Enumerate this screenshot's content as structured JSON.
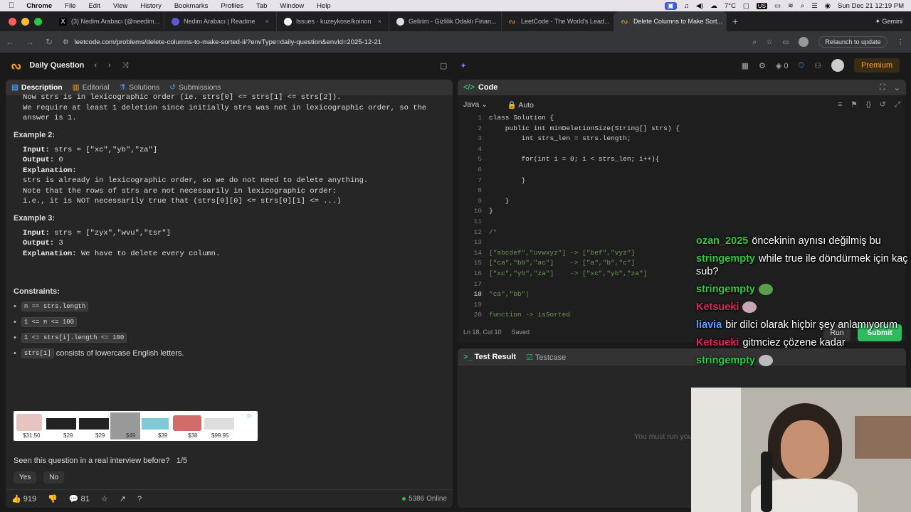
{
  "macos": {
    "app": "Chrome",
    "menus": [
      "File",
      "Edit",
      "View",
      "History",
      "Bookmarks",
      "Profiles",
      "Tab",
      "Window",
      "Help"
    ],
    "temp": "7°C",
    "input": "US",
    "datetime": "Sun Dec 21  12:19 PM"
  },
  "tabs": [
    {
      "label": "(3) Nedim Arabacı (@needim...",
      "color": "#000000"
    },
    {
      "label": "Nedim Arabacı | Readme",
      "color": "#5b5bd6"
    },
    {
      "label": "Issues · kuzeykose/koinon",
      "color": "#ffffff"
    },
    {
      "label": "Gelirim - Gizlilik Odaklı Finan...",
      "color": "#ffffff"
    },
    {
      "label": "LeetCode - The World's Lead...",
      "color": "#ffa116"
    },
    {
      "label": "Delete Columns to Make Sort...",
      "color": "#ffa116"
    }
  ],
  "gemini": "Gemini",
  "address": {
    "url": "leetcode.com/problems/delete-columns-to-make-sorted-ii/?envType=daily-question&envId=2025-12-21",
    "relaunch": "Relaunch to update"
  },
  "lc": {
    "title": "Daily Question",
    "fire": "0",
    "premium": "Premium"
  },
  "left_tabs": {
    "description": "Description",
    "editorial": "Editorial",
    "solutions": "Solutions",
    "submissions": "Submissions"
  },
  "desc": {
    "top1": "Now strs is in lexicographic order (ie. strs[0] <= strs[1] <= strs[2]).",
    "top2": "We require at least 1 deletion since initially strs was not in lexicographic order, so the",
    "top3": "answer is 1.",
    "ex2": "Example 2:",
    "ex2_input_label": "Input:",
    "ex2_input": "strs = [\"xc\",\"yb\",\"za\"]",
    "ex2_output_label": "Output:",
    "ex2_output": "0",
    "ex2_expl_label": "Explanation:",
    "ex2_l1": "strs is already in lexicographic order, so we do not need to delete anything.",
    "ex2_l2": "Note that the rows of strs are not necessarily in lexicographic order:",
    "ex2_l3": "i.e., it is NOT necessarily true that (strs[0][0] <= strs[0][1] <= ...)",
    "ex3": "Example 3:",
    "ex3_input_label": "Input:",
    "ex3_input": "strs = [\"zyx\",\"wvu\",\"tsr\"]",
    "ex3_output_label": "Output:",
    "ex3_output": "3",
    "ex3_expl_label": "Explanation:",
    "ex3_expl": "We have to delete every column.",
    "constraints": "Constraints:",
    "c1": "n == strs.length",
    "c2": "1 <= n <= 100",
    "c3": "1 <= strs[i].length <= 100",
    "c4_code": "strs[i]",
    "c4_text": "consists of lowercase English letters."
  },
  "ad": {
    "prices": [
      "$31.50",
      "$29",
      "$29",
      "$49",
      "$39",
      "$38",
      "$99.95"
    ]
  },
  "seen": {
    "question": "Seen this question in a real interview before?",
    "count": "1/5",
    "yes": "Yes",
    "no": "No"
  },
  "bottom": {
    "likes": "919",
    "comments": "81",
    "online": "5386 Online"
  },
  "code": {
    "title": "Code",
    "lang": "Java",
    "auto": "Auto",
    "status_pos": "Ln 18, Col 10",
    "status_saved": "Saved",
    "run": "Run",
    "submit": "Submit"
  },
  "code_lines": [
    {
      "n": "1",
      "t": "class Solution {"
    },
    {
      "n": "2",
      "t": "    public int minDeletionSize(String[] strs) {"
    },
    {
      "n": "3",
      "t": "        int strs_len = strs.length;"
    },
    {
      "n": "4",
      "t": ""
    },
    {
      "n": "5",
      "t": "        for(int i = 0; i < strs_len; i++){"
    },
    {
      "n": "6",
      "t": ""
    },
    {
      "n": "7",
      "t": "        }"
    },
    {
      "n": "8",
      "t": ""
    },
    {
      "n": "9",
      "t": "    }"
    },
    {
      "n": "10",
      "t": "}"
    },
    {
      "n": "11",
      "t": ""
    },
    {
      "n": "12",
      "t": "/*"
    },
    {
      "n": "13",
      "t": ""
    },
    {
      "n": "14",
      "t": "[\"abcdef\",\"uvwxyz\"] -> [\"bef\",\"vyz\"]"
    },
    {
      "n": "15",
      "t": "[\"ca\",\"bb\",\"ac\"]    -> [\"a\",\"b\",\"c\"]"
    },
    {
      "n": "16",
      "t": "[\"xc\",\"yb\",\"za\"]    -> [\"xc\",\"yb\",\"za\"]"
    },
    {
      "n": "17",
      "t": ""
    },
    {
      "n": "18",
      "t": "\"ca\",\"bb\"|"
    },
    {
      "n": "19",
      "t": ""
    },
    {
      "n": "20",
      "t": "function -> isSorted"
    }
  ],
  "test": {
    "result": "Test Result",
    "testcase": "Testcase",
    "mustrun": "You must run you"
  },
  "chat": [
    {
      "user": "ozan_2025",
      "color": "#2ecc40",
      "text": "öncekinin aynısı değilmiş bu"
    },
    {
      "user": "stringempty",
      "color": "#2ecc40",
      "text": "while true ile döndürmek için kaç sub?"
    },
    {
      "user": "stringempty",
      "color": "#2ecc40",
      "text": ""
    },
    {
      "user": "Ketsueki",
      "color": "#e0245e",
      "text": ""
    },
    {
      "user": "liavia",
      "color": "#4da3ff",
      "text": "bir dilci olarak hiçbir şey anlamıyorum"
    },
    {
      "user": "Ketsueki",
      "color": "#e0245e",
      "text": "gitmciez çözene kadar"
    },
    {
      "user": "stringempty",
      "color": "#2ecc40",
      "text": ""
    }
  ]
}
